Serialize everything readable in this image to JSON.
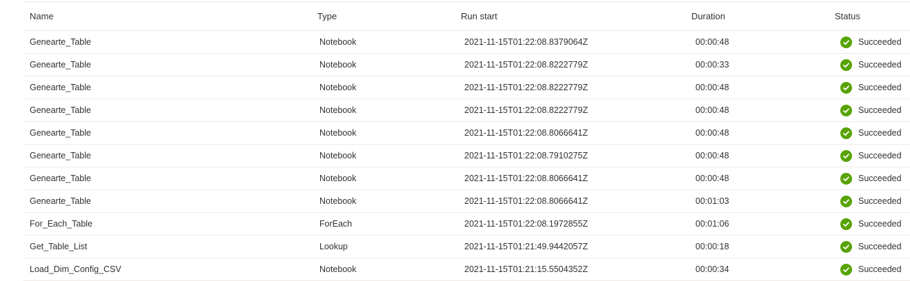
{
  "columns": {
    "name": "Name",
    "type": "Type",
    "run_start": "Run start",
    "duration": "Duration",
    "status": "Status"
  },
  "status_color": "#57a300",
  "rows": [
    {
      "name": "Genearte_Table",
      "type": "Notebook",
      "run_start": "2021-11-15T01:22:08.8379064Z",
      "duration": "00:00:48",
      "status": "Succeeded"
    },
    {
      "name": "Genearte_Table",
      "type": "Notebook",
      "run_start": "2021-11-15T01:22:08.8222779Z",
      "duration": "00:00:33",
      "status": "Succeeded"
    },
    {
      "name": "Genearte_Table",
      "type": "Notebook",
      "run_start": "2021-11-15T01:22:08.8222779Z",
      "duration": "00:00:48",
      "status": "Succeeded"
    },
    {
      "name": "Genearte_Table",
      "type": "Notebook",
      "run_start": "2021-11-15T01:22:08.8222779Z",
      "duration": "00:00:48",
      "status": "Succeeded"
    },
    {
      "name": "Genearte_Table",
      "type": "Notebook",
      "run_start": "2021-11-15T01:22:08.8066641Z",
      "duration": "00:00:48",
      "status": "Succeeded"
    },
    {
      "name": "Genearte_Table",
      "type": "Notebook",
      "run_start": "2021-11-15T01:22:08.7910275Z",
      "duration": "00:00:48",
      "status": "Succeeded"
    },
    {
      "name": "Genearte_Table",
      "type": "Notebook",
      "run_start": "2021-11-15T01:22:08.8066641Z",
      "duration": "00:00:48",
      "status": "Succeeded"
    },
    {
      "name": "Genearte_Table",
      "type": "Notebook",
      "run_start": "2021-11-15T01:22:08.8066641Z",
      "duration": "00:01:03",
      "status": "Succeeded"
    },
    {
      "name": "For_Each_Table",
      "type": "ForEach",
      "run_start": "2021-11-15T01:22:08.1972855Z",
      "duration": "00:01:06",
      "status": "Succeeded"
    },
    {
      "name": "Get_Table_List",
      "type": "Lookup",
      "run_start": "2021-11-15T01:21:49.9442057Z",
      "duration": "00:00:18",
      "status": "Succeeded"
    },
    {
      "name": "Load_Dim_Config_CSV",
      "type": "Notebook",
      "run_start": "2021-11-15T01:21:15.5504352Z",
      "duration": "00:00:34",
      "status": "Succeeded"
    }
  ]
}
